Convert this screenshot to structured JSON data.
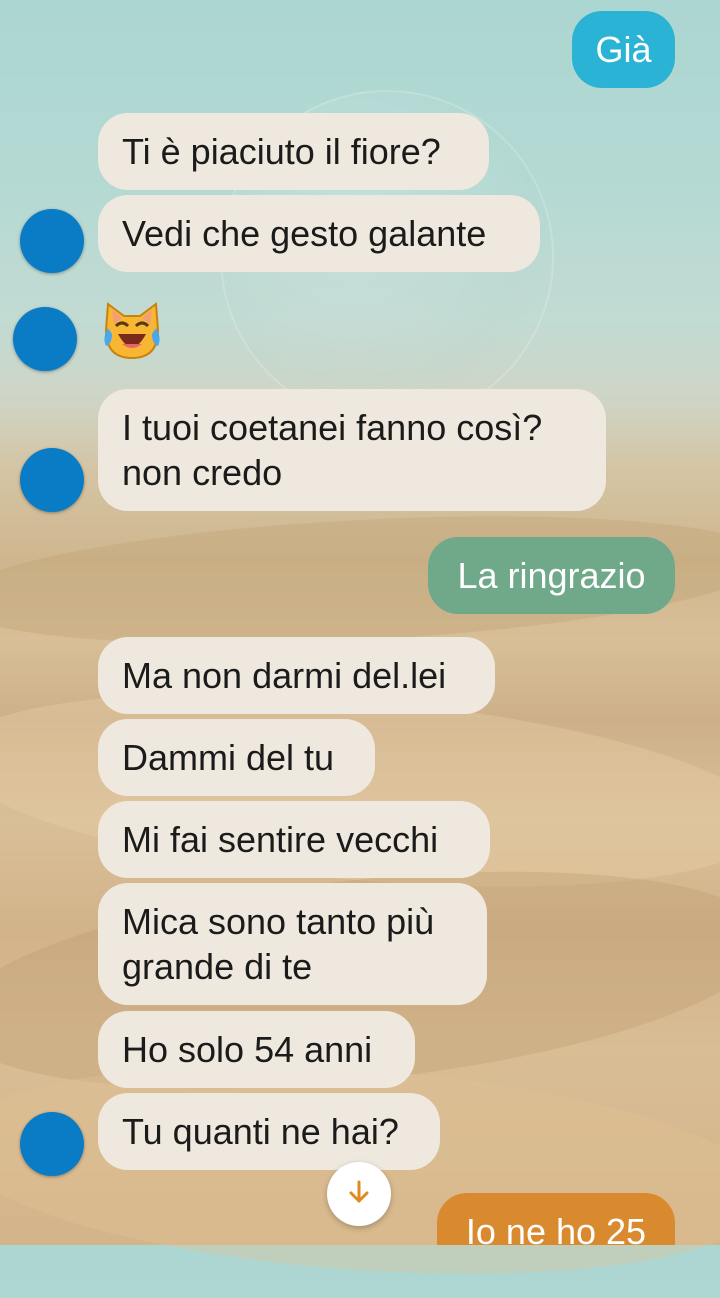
{
  "messages": [
    {
      "id": "m1",
      "direction": "outgoing",
      "text": "Già"
    },
    {
      "id": "m2",
      "direction": "incoming",
      "text": "Ti è piaciuto il fiore?"
    },
    {
      "id": "m3",
      "direction": "incoming",
      "text": "Vedi che gesto galante"
    },
    {
      "id": "m4",
      "direction": "incoming",
      "emoji": "cat-face-with-tears-of-joy"
    },
    {
      "id": "m5",
      "direction": "incoming",
      "text": "I tuoi coetanei fanno così?\nnon credo"
    },
    {
      "id": "m6",
      "direction": "outgoing",
      "text": "La ringrazio"
    },
    {
      "id": "m7",
      "direction": "incoming",
      "text": "Ma non darmi del.lei"
    },
    {
      "id": "m8",
      "direction": "incoming",
      "text": "Dammi del tu"
    },
    {
      "id": "m9",
      "direction": "incoming",
      "text": "Mi fai sentire vecchi"
    },
    {
      "id": "m10",
      "direction": "incoming",
      "text": "Mica sono tanto più\ngrande di te"
    },
    {
      "id": "m11",
      "direction": "incoming",
      "text": "Ho solo 54 anni"
    },
    {
      "id": "m12",
      "direction": "incoming",
      "text": "Tu quanti ne hai?"
    },
    {
      "id": "m13",
      "direction": "outgoing",
      "text": "Io ne ho 25"
    }
  ],
  "colors": {
    "incoming_bubble": "#efe8de",
    "outgoing_teal": "#2bb3d6",
    "outgoing_green": "#6fa98a",
    "outgoing_orange": "#d98a2f",
    "avatar": "#0a7cc6"
  },
  "icons": {
    "scroll_down": "arrow-down-icon",
    "reaction": "cat-face-with-tears-of-joy"
  }
}
